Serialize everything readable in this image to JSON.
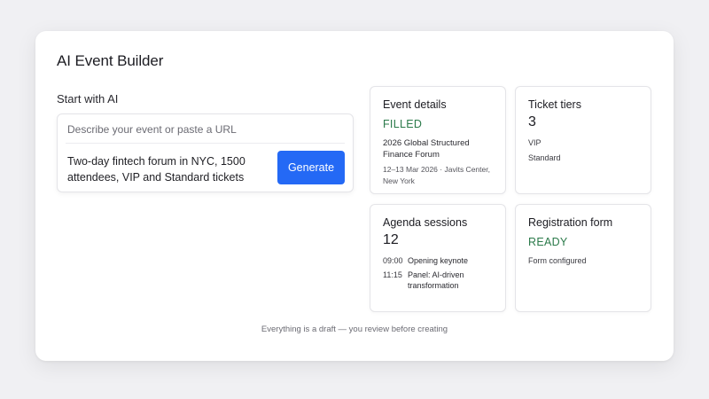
{
  "app": {
    "title": "AI Event Builder"
  },
  "ai_input": {
    "section_label": "Start with AI",
    "placeholder": "Describe your event or paste a URL",
    "prompt": "Two-day fintech forum in NYC, 1500 attendees, VIP and Standard tickets",
    "generate_label": "Generate",
    "accent_color": "#2469f5"
  },
  "tiles": {
    "event_details": {
      "title": "Event details",
      "status": "FILLED",
      "event_name": "2026 Global Structured Finance Forum",
      "event_meta": "12–13 Mar 2026 · Javits Center, New York"
    },
    "ticket_tiers": {
      "title": "Ticket tiers",
      "count": "3",
      "items": [
        "VIP",
        "Standard"
      ]
    },
    "agenda_sessions": {
      "title": "Agenda sessions",
      "count": "12",
      "sessions": [
        {
          "time": "09:00",
          "name": "Opening keynote"
        },
        {
          "time": "11:15",
          "name": "Panel: AI-driven transformation"
        }
      ]
    },
    "registration_form": {
      "title": "Registration form",
      "status": "READY",
      "note": "Form configured"
    },
    "status_color": "#2b7a4a"
  },
  "footer": {
    "note": "Everything is a draft — you review before creating"
  }
}
